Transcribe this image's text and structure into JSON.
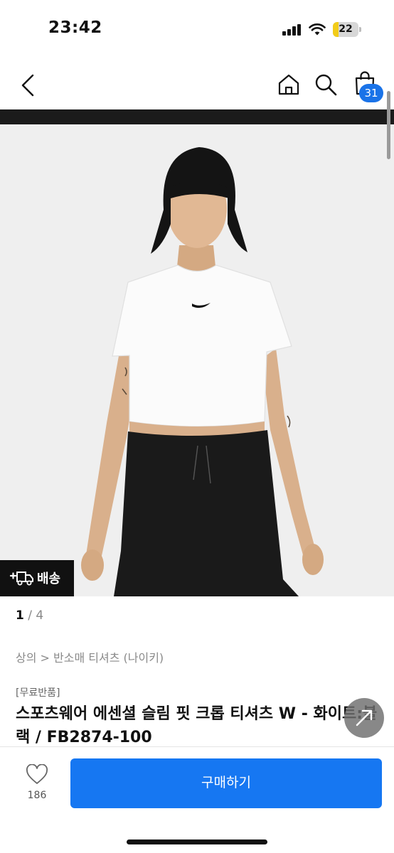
{
  "status_bar": {
    "time": "23:42",
    "battery_level": "22",
    "battery_fill_fraction": 0.22,
    "icons": [
      "cellular-signal-icon",
      "wifi-icon",
      "battery-icon"
    ]
  },
  "nav": {
    "icons": [
      "back-icon",
      "home-icon",
      "search-icon",
      "shopping-bag-icon"
    ],
    "cart_count": "31",
    "badge_color": "#1a73e8"
  },
  "gallery": {
    "delivery_label": "배송",
    "delivery_icon": "delivery-truck-icon",
    "current_page": "1",
    "separator": " / ",
    "total_pages": "4"
  },
  "product": {
    "breadcrumb": "상의 > 반소매 티셔츠 (나이키)",
    "tag": "[무료반품]",
    "title": "스포츠웨어 에센셜 슬림 핏 크롭 티셔츠 W - 화이트:블랙 / FB2874-100",
    "share_icon": "share-arrow-icon"
  },
  "bottom_bar": {
    "like_icon": "heart-icon",
    "like_count": "186",
    "buy_label": "구매하기",
    "buy_color": "#1677f2"
  }
}
